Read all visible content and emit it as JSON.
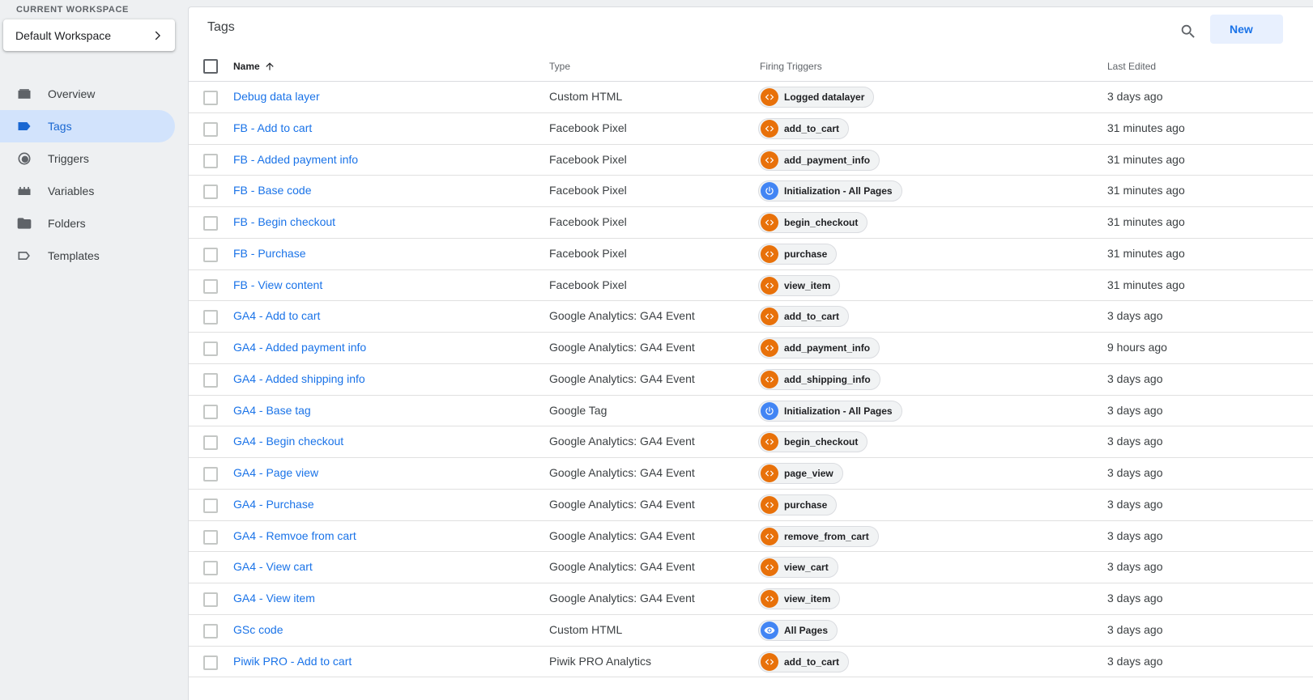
{
  "workspace": {
    "label": "CURRENT WORKSPACE",
    "name": "Default Workspace"
  },
  "nav": [
    {
      "id": "overview",
      "label": "Overview",
      "icon": "overview-icon"
    },
    {
      "id": "tags",
      "label": "Tags",
      "icon": "tag-icon",
      "active": true
    },
    {
      "id": "triggers",
      "label": "Triggers",
      "icon": "trigger-icon"
    },
    {
      "id": "variables",
      "label": "Variables",
      "icon": "variables-icon"
    },
    {
      "id": "folders",
      "label": "Folders",
      "icon": "folder-icon"
    },
    {
      "id": "templates",
      "label": "Templates",
      "icon": "template-icon"
    }
  ],
  "main": {
    "title": "Tags",
    "new_label": "New",
    "columns": {
      "name": "Name",
      "type": "Type",
      "triggers": "Firing Triggers",
      "edited": "Last Edited"
    }
  },
  "colors": {
    "accent": "#1a73e8",
    "active_nav": "#d2e3fc",
    "custom_event": "#e8710a",
    "builtin_trigger": "#4285f4"
  },
  "rows": [
    {
      "name": "Debug data layer",
      "type": "Custom HTML",
      "trigger": "Logged datalayer",
      "trigger_icon": "custom-event-icon",
      "edited": "3 days ago"
    },
    {
      "name": "FB - Add to cart",
      "type": "Facebook Pixel",
      "trigger": "add_to_cart",
      "trigger_icon": "custom-event-icon",
      "edited": "31 minutes ago"
    },
    {
      "name": "FB - Added payment info",
      "type": "Facebook Pixel",
      "trigger": "add_payment_info",
      "trigger_icon": "custom-event-icon",
      "edited": "31 minutes ago"
    },
    {
      "name": "FB - Base code",
      "type": "Facebook Pixel",
      "trigger": "Initialization - All Pages",
      "trigger_icon": "power-icon",
      "edited": "31 minutes ago"
    },
    {
      "name": "FB - Begin checkout",
      "type": "Facebook Pixel",
      "trigger": "begin_checkout",
      "trigger_icon": "custom-event-icon",
      "edited": "31 minutes ago"
    },
    {
      "name": "FB - Purchase",
      "type": "Facebook Pixel",
      "trigger": "purchase",
      "trigger_icon": "custom-event-icon",
      "edited": "31 minutes ago"
    },
    {
      "name": "FB - View content",
      "type": "Facebook Pixel",
      "trigger": "view_item",
      "trigger_icon": "custom-event-icon",
      "edited": "31 minutes ago"
    },
    {
      "name": "GA4 - Add to cart",
      "type": "Google Analytics: GA4 Event",
      "trigger": "add_to_cart",
      "trigger_icon": "custom-event-icon",
      "edited": "3 days ago"
    },
    {
      "name": "GA4 - Added payment info",
      "type": "Google Analytics: GA4 Event",
      "trigger": "add_payment_info",
      "trigger_icon": "custom-event-icon",
      "edited": "9 hours ago"
    },
    {
      "name": "GA4 - Added shipping info",
      "type": "Google Analytics: GA4 Event",
      "trigger": "add_shipping_info",
      "trigger_icon": "custom-event-icon",
      "edited": "3 days ago"
    },
    {
      "name": "GA4 - Base tag",
      "type": "Google Tag",
      "trigger": "Initialization - All Pages",
      "trigger_icon": "power-icon",
      "edited": "3 days ago"
    },
    {
      "name": "GA4 - Begin checkout",
      "type": "Google Analytics: GA4 Event",
      "trigger": "begin_checkout",
      "trigger_icon": "custom-event-icon",
      "edited": "3 days ago"
    },
    {
      "name": "GA4 - Page view",
      "type": "Google Analytics: GA4 Event",
      "trigger": "page_view",
      "trigger_icon": "custom-event-icon",
      "edited": "3 days ago"
    },
    {
      "name": "GA4 - Purchase",
      "type": "Google Analytics: GA4 Event",
      "trigger": "purchase",
      "trigger_icon": "custom-event-icon",
      "edited": "3 days ago"
    },
    {
      "name": "GA4 - Remvoe from cart",
      "type": "Google Analytics: GA4 Event",
      "trigger": "remove_from_cart",
      "trigger_icon": "custom-event-icon",
      "edited": "3 days ago"
    },
    {
      "name": "GA4 - View cart",
      "type": "Google Analytics: GA4 Event",
      "trigger": "view_cart",
      "trigger_icon": "custom-event-icon",
      "edited": "3 days ago"
    },
    {
      "name": "GA4 - View item",
      "type": "Google Analytics: GA4 Event",
      "trigger": "view_item",
      "trigger_icon": "custom-event-icon",
      "edited": "3 days ago"
    },
    {
      "name": "GSc code",
      "type": "Custom HTML",
      "trigger": "All Pages",
      "trigger_icon": "eye-icon",
      "edited": "3 days ago"
    },
    {
      "name": "Piwik PRO - Add to cart",
      "type": "Piwik PRO Analytics",
      "trigger": "add_to_cart",
      "trigger_icon": "custom-event-icon",
      "edited": "3 days ago"
    }
  ]
}
